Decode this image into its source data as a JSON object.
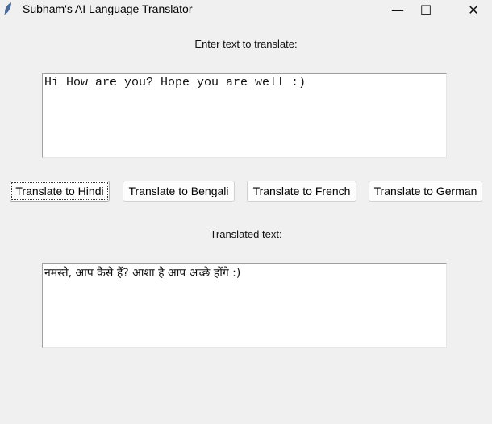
{
  "window": {
    "title": "Subham's AI Language Translator",
    "minimize": "—",
    "maximize": "☐",
    "close": "✕"
  },
  "input": {
    "label": "Enter text to translate:",
    "value": "Hi How are you? Hope you are well :)"
  },
  "buttons": [
    {
      "label": "Translate to Hindi"
    },
    {
      "label": "Translate to Bengali"
    },
    {
      "label": "Translate to French"
    },
    {
      "label": "Translate to German"
    }
  ],
  "output": {
    "label": "Translated text:",
    "value": "नमस्ते, आप कैसे हैं? आशा है आप अच्छे होंगे :)"
  }
}
